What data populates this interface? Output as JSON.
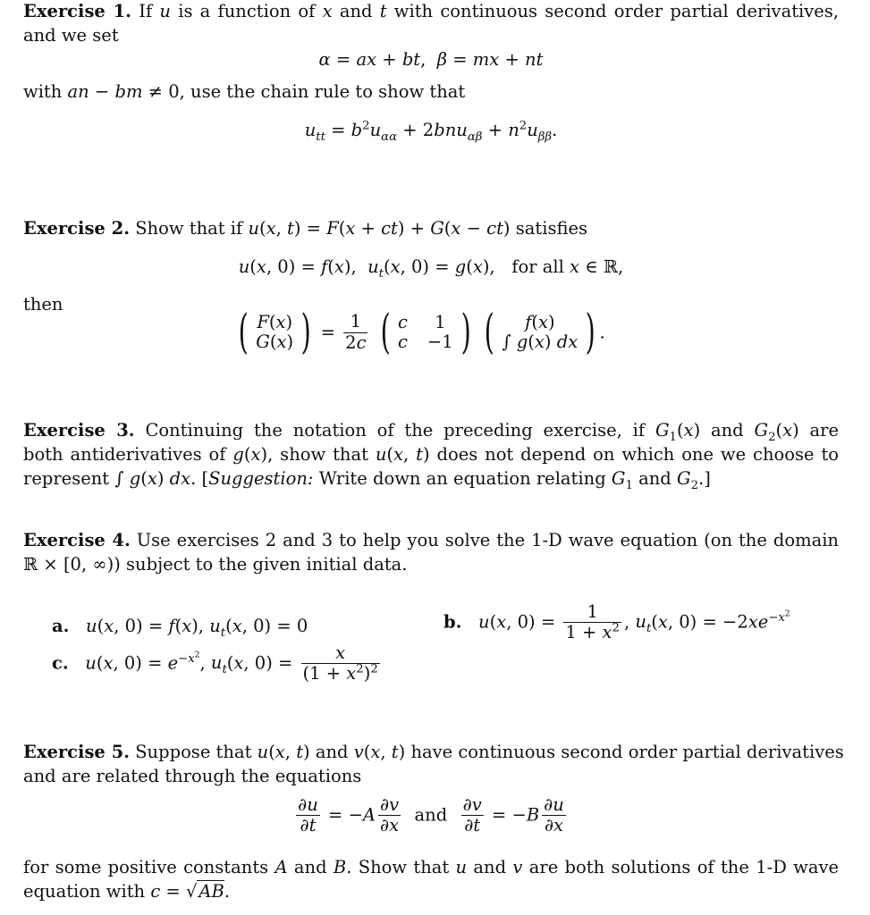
{
  "exercises": [
    {
      "label": "Exercise 1.",
      "line1": "If u is a function of x and t with continuous second order partial derivatives,",
      "line2": "and we set",
      "eq1": "α = ax + bt,  β = mx + nt",
      "line3": "with an − bm ≠ 0, use the chain rule to show that",
      "eq2": "u_tt = b²u_αα + 2bnu_αβ + n²u_ββ."
    },
    {
      "label": "Exercise 2.",
      "line1": "Show that if u(x,t) = F(x + ct) + G(x − ct) satisfies",
      "eq1": "u(x,0) = f(x),  u_t(x,0) = g(x),   for all x ∈ ℝ,",
      "then": "then",
      "matrix_eq": "(F(x); G(x)) = 1/(2c) (c 1; c −1) (f(x); ∫g(x) dx)."
    },
    {
      "label": "Exercise 3.",
      "line1": "Continuing the notation of the preceding exercise, if G₁(x) and G₂(x) are",
      "line2": "both antiderivatives of g(x), show that u(x,t) does not depend on which one we choose to",
      "line3": "represent ∫ g(x) dx. [Suggestion: Write down an equation relating G₁ and G₂.]"
    },
    {
      "label": "Exercise 4.",
      "line1": "Use exercises 2 and 3 to help you solve the 1-D wave equation (on the domain",
      "line2": "ℝ × [0, ∞)) subject to the given initial data.",
      "parts": [
        {
          "label": "a.",
          "text": "u(x,0) = f(x), u_t(x,0) = 0"
        },
        {
          "label": "b.",
          "text": "u(x,0) = 1/(1 + x²), u_t(x,0) = −2xe^(−x²)"
        },
        {
          "label": "c.",
          "text": "u(x,0) = e^(−x²), u_t(x,0) = x/(1 + x²)²"
        }
      ]
    },
    {
      "label": "Exercise 5.",
      "line1": "Suppose that u(x,t) and v(x,t) have continuous second order partial derivatives",
      "line2": "and are related through the equations",
      "eq1": "∂u/∂t = −A ∂v/∂x  and  ∂v/∂t = −B ∂u/∂x",
      "line3": "for some positive constants A and B. Show that u and v are both solutions of the 1-D wave",
      "line4": "equation with c = √(AB)."
    }
  ],
  "text": {
    "ex1_pre": "If",
    "ex1_mid1": "is a function of",
    "ex1_and": "and",
    "ex1_rest": "with continuous second order partial derivatives,",
    "we_set": "and we set",
    "with": "with",
    "chain": ", use the chain rule to show that",
    "show_if": "Show that if",
    "satisfies": "satisfies",
    "for_all": "for all",
    "then": "then",
    "ex3_l1a": "Continuing the notation of the preceding exercise, if",
    "are": "are",
    "ex3_l2a": "both antiderivatives of",
    "ex3_l2b": ", show that",
    "ex3_l2c": "does not depend on which one we choose to",
    "represent": "represent",
    "suggestion": "Suggestion:",
    "ex3_l3b": "Write down an equation relating",
    "ex4_l1": "Use exercises 2 and 3 to help you solve the 1-D wave equation (on the domain",
    "ex4_l2": "subject to the given initial data.",
    "ex5_l1a": "Suppose that",
    "ex5_l1b": "have continuous second order partial derivatives",
    "ex5_l2": "and are related through the equations",
    "for_some": "for some positive constants",
    "show_that": ". Show that",
    "both_sol": "are both solutions of the 1-D wave",
    "eq_with": "equation with"
  }
}
